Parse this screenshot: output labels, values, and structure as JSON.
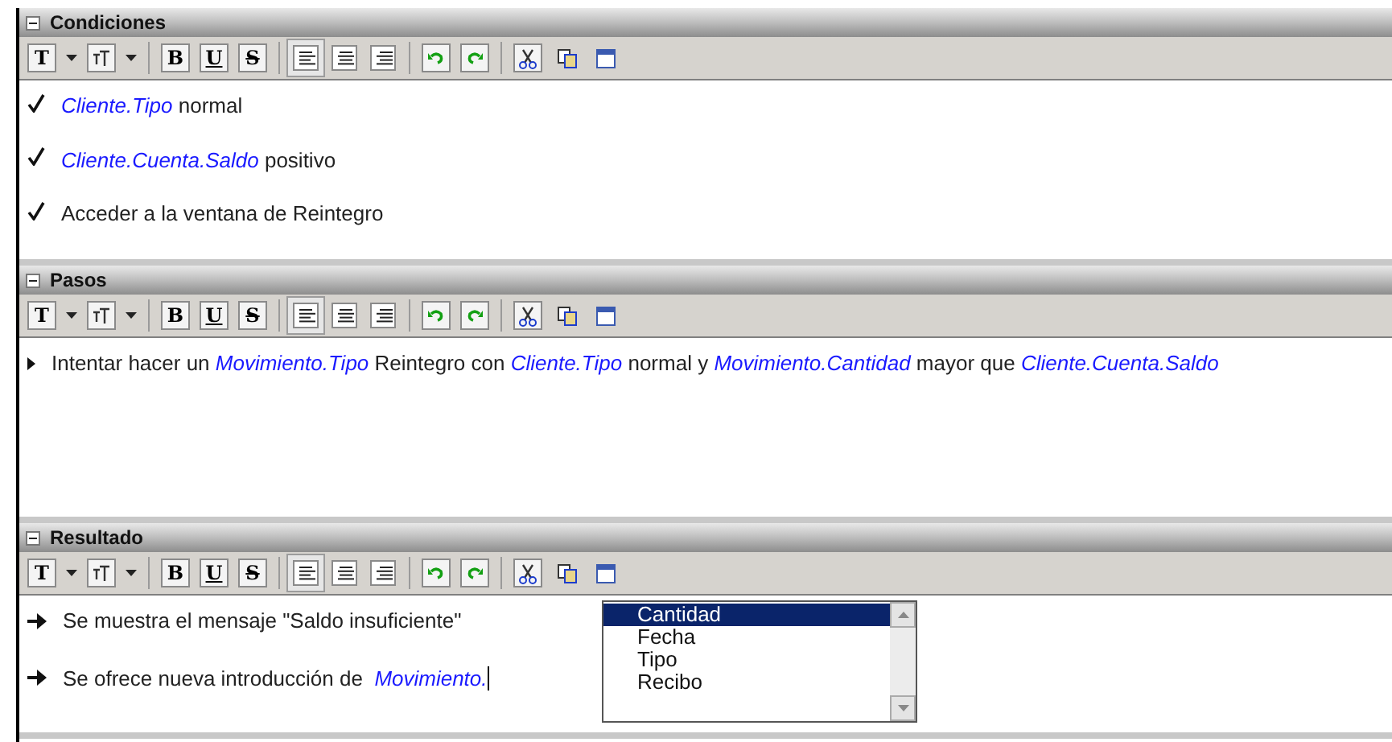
{
  "sections": [
    {
      "title": "Condiciones",
      "expanded": true,
      "toolbar": [
        {
          "kind": "text-style",
          "label": "T"
        },
        {
          "kind": "dropdown"
        },
        {
          "kind": "font-size"
        },
        {
          "kind": "dropdown"
        },
        {
          "kind": "separator"
        },
        {
          "kind": "bold",
          "label": "B"
        },
        {
          "kind": "underline",
          "label": "U"
        },
        {
          "kind": "strike",
          "label": "S"
        },
        {
          "kind": "separator"
        },
        {
          "kind": "align-left",
          "pressed": true
        },
        {
          "kind": "align-center",
          "pressed": false
        },
        {
          "kind": "align-right",
          "pressed": false
        },
        {
          "kind": "separator"
        },
        {
          "kind": "undo"
        },
        {
          "kind": "redo"
        },
        {
          "kind": "separator"
        },
        {
          "kind": "cut"
        },
        {
          "kind": "paste"
        },
        {
          "kind": "window"
        }
      ],
      "lines": [
        {
          "kind": "check",
          "text": "*Cliente.Tipo* normal"
        },
        {
          "kind": "check",
          "text": "*Cliente.Cuenta.Saldo* positivo"
        },
        {
          "kind": "check",
          "text": "Acceder a la ventana de Reintegro"
        }
      ]
    },
    {
      "title": "Pasos",
      "expanded": true,
      "toolbar": [
        {
          "kind": "text-style",
          "label": "T"
        },
        {
          "kind": "dropdown"
        },
        {
          "kind": "font-size"
        },
        {
          "kind": "dropdown"
        },
        {
          "kind": "separator"
        },
        {
          "kind": "bold",
          "label": "B"
        },
        {
          "kind": "underline",
          "label": "U"
        },
        {
          "kind": "strike",
          "label": "S"
        },
        {
          "kind": "separator"
        },
        {
          "kind": "align-left",
          "pressed": true
        },
        {
          "kind": "align-center",
          "pressed": false
        },
        {
          "kind": "align-right",
          "pressed": false
        },
        {
          "kind": "separator"
        },
        {
          "kind": "undo"
        },
        {
          "kind": "redo"
        },
        {
          "kind": "separator"
        },
        {
          "kind": "cut"
        },
        {
          "kind": "paste"
        },
        {
          "kind": "window"
        }
      ],
      "lines": [
        {
          "kind": "step",
          "text": "Intentar hacer un *Movimiento.Tipo* Reintegro con *Cliente.Tipo* normal y *Movimiento.Cantidad* mayor que *Cliente.Cuenta.Saldo*"
        }
      ]
    },
    {
      "title": "Resultado",
      "expanded": true,
      "toolbar": [
        {
          "kind": "text-style",
          "label": "T"
        },
        {
          "kind": "dropdown"
        },
        {
          "kind": "font-size"
        },
        {
          "kind": "dropdown"
        },
        {
          "kind": "separator"
        },
        {
          "kind": "bold",
          "label": "B"
        },
        {
          "kind": "underline",
          "label": "U"
        },
        {
          "kind": "strike",
          "label": "S"
        },
        {
          "kind": "separator"
        },
        {
          "kind": "align-left",
          "pressed": true
        },
        {
          "kind": "align-center",
          "pressed": false
        },
        {
          "kind": "align-right",
          "pressed": false
        },
        {
          "kind": "separator"
        },
        {
          "kind": "undo"
        },
        {
          "kind": "redo"
        },
        {
          "kind": "separator"
        },
        {
          "kind": "cut"
        },
        {
          "kind": "paste"
        },
        {
          "kind": "window"
        }
      ],
      "lines": [
        {
          "kind": "result",
          "text": "Se muestra el mensaje \"Saldo insuficiente\""
        },
        {
          "kind": "result",
          "text": "Se ofrece nueva introducción de  *Movimiento.*",
          "cursor": true
        }
      ],
      "autocomplete": [
        {
          "label": "Cantidad",
          "selected": true
        },
        {
          "label": "Fecha",
          "selected": false
        },
        {
          "label": "Tipo",
          "selected": false
        },
        {
          "label": "Recibo",
          "selected": false
        }
      ]
    }
  ]
}
